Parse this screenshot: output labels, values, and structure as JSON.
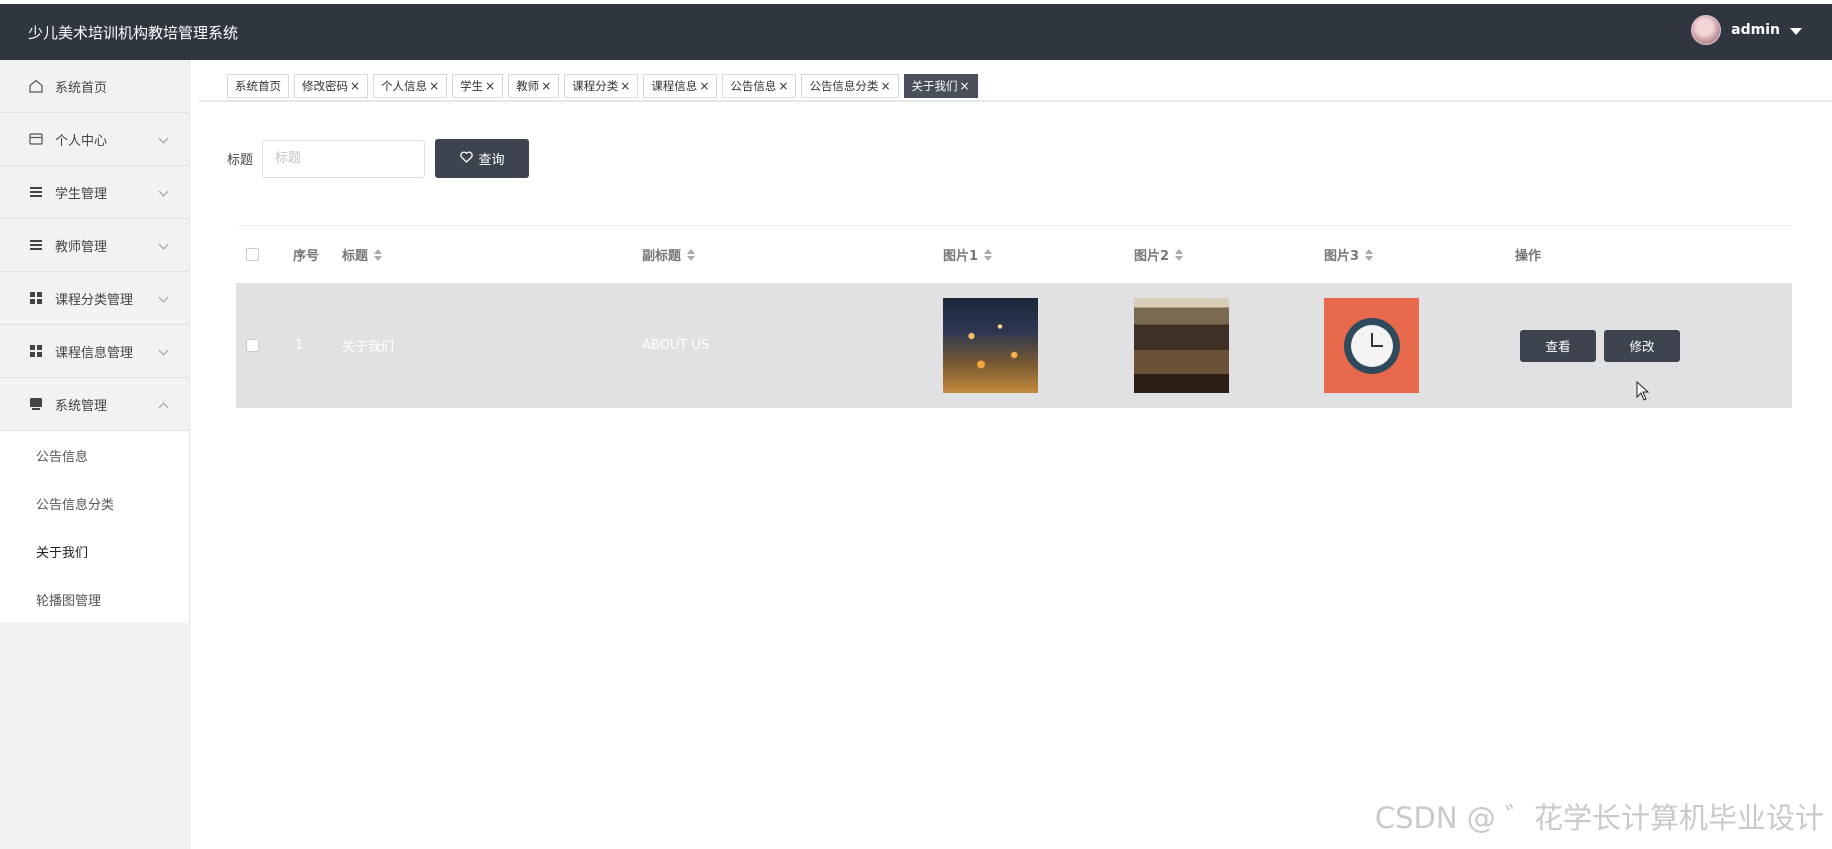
{
  "app": {
    "title": "少儿美术培训机构教培管理系统"
  },
  "user": {
    "name": "admin"
  },
  "sidebar": {
    "items": [
      {
        "label": "系统首页",
        "icon": "home-icon"
      },
      {
        "label": "个人中心",
        "icon": "card-icon"
      },
      {
        "label": "学生管理",
        "icon": "list-icon"
      },
      {
        "label": "教师管理",
        "icon": "list-icon"
      },
      {
        "label": "课程分类管理",
        "icon": "grid-icon"
      },
      {
        "label": "课程信息管理",
        "icon": "grid-icon"
      },
      {
        "label": "系统管理",
        "icon": "monitor-icon"
      }
    ],
    "submenu": [
      "公告信息",
      "公告信息分类",
      "关于我们",
      "轮播图管理"
    ]
  },
  "tabs": [
    {
      "label": "系统首页",
      "close": ""
    },
    {
      "label": "修改密码",
      "close": "×"
    },
    {
      "label": "个人信息",
      "close": "×"
    },
    {
      "label": "学生",
      "close": "×"
    },
    {
      "label": "教师",
      "close": "×"
    },
    {
      "label": "课程分类",
      "close": "×"
    },
    {
      "label": "课程信息",
      "close": "×"
    },
    {
      "label": "公告信息",
      "close": "×"
    },
    {
      "label": "公告信息分类",
      "close": "×"
    },
    {
      "label": "关于我们",
      "close": "×"
    }
  ],
  "search": {
    "label": "标题",
    "placeholder": "标题",
    "button": "查询"
  },
  "table": {
    "headers": [
      "序号",
      "标题",
      "副标题",
      "图片1",
      "图片2",
      "图片3",
      "操作"
    ],
    "rows": [
      {
        "index": "1",
        "title": "关于我们",
        "subtitle": "ABOUT US",
        "view": "查看",
        "edit": "修改"
      }
    ]
  },
  "watermark": "CSDN @ ゛花学长计算机毕业设计",
  "colors": {
    "topbar": "#2f3640",
    "button": "#3d4450",
    "row_highlight": "#e1e1e3"
  }
}
